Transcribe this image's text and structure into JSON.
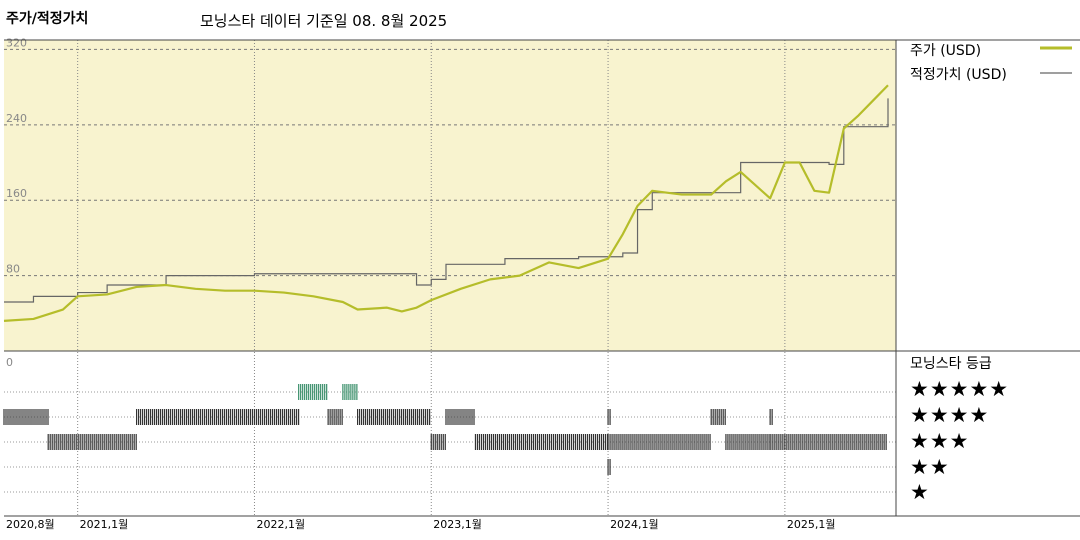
{
  "header": {
    "title": "주가/적정가치",
    "subtitle": "모닝스타 데이터 기준일 08. 8월 2025"
  },
  "legend": {
    "price_label": "주가 (USD)",
    "fair_label": "적정가치 (USD)",
    "price_color": "#b5bd2a",
    "fair_color": "#666666"
  },
  "rating": {
    "title": "모닝스타 등급",
    "rows": [
      "★★★★★",
      "★★★★",
      "★★★",
      "★★",
      "★"
    ]
  },
  "colors": {
    "panel_bg": "#f8f3cf",
    "five_star": "#3a8f6a",
    "bars": "#333333"
  },
  "chart_data": {
    "type": "line",
    "y_axis": {
      "ticks": [
        80,
        160,
        240,
        320
      ],
      "ylim": [
        0,
        330
      ],
      "grid": "dashed"
    },
    "rating_axis_label": "0",
    "x_axis": {
      "range": [
        "2020-08",
        "2025-08"
      ],
      "ticks": [
        {
          "date": "2020-08",
          "label": "2020,8월"
        },
        {
          "date": "2021-01",
          "label": "2021,1월"
        },
        {
          "date": "2022-01",
          "label": "2022,1월"
        },
        {
          "date": "2023-01",
          "label": "2023,1월"
        },
        {
          "date": "2024-01",
          "label": "2024,1월"
        },
        {
          "date": "2025-01",
          "label": "2025,1월"
        }
      ]
    },
    "price_series": {
      "name": "주가 (USD)",
      "points": [
        [
          "2020-08",
          32
        ],
        [
          "2020-10",
          34
        ],
        [
          "2020-12",
          44
        ],
        [
          "2021-01",
          58
        ],
        [
          "2021-03",
          60
        ],
        [
          "2021-05",
          68
        ],
        [
          "2021-07",
          70
        ],
        [
          "2021-09",
          66
        ],
        [
          "2021-11",
          64
        ],
        [
          "2022-01",
          64
        ],
        [
          "2022-03",
          62
        ],
        [
          "2022-05",
          58
        ],
        [
          "2022-07",
          52
        ],
        [
          "2022-08",
          44
        ],
        [
          "2022-10",
          46
        ],
        [
          "2022-11",
          42
        ],
        [
          "2022-12",
          46
        ],
        [
          "2023-01",
          54
        ],
        [
          "2023-03",
          66
        ],
        [
          "2023-05",
          76
        ],
        [
          "2023-07",
          80
        ],
        [
          "2023-09",
          94
        ],
        [
          "2023-11",
          88
        ],
        [
          "2024-01",
          98
        ],
        [
          "2024-02",
          124
        ],
        [
          "2024-03",
          154
        ],
        [
          "2024-04",
          170
        ],
        [
          "2024-06",
          166
        ],
        [
          "2024-08",
          166
        ],
        [
          "2024-09",
          180
        ],
        [
          "2024-10",
          190
        ],
        [
          "2024-12",
          162
        ],
        [
          "2025-01",
          200
        ],
        [
          "2025-02",
          200
        ],
        [
          "2025-03",
          170
        ],
        [
          "2025-04",
          168
        ],
        [
          "2025-05",
          236
        ],
        [
          "2025-06",
          250
        ],
        [
          "2025-07",
          266
        ],
        [
          "2025-08",
          282
        ]
      ]
    },
    "fair_value_series": {
      "name": "적정가치 (USD)",
      "points": [
        [
          "2020-08",
          52
        ],
        [
          "2020-10",
          58
        ],
        [
          "2021-01",
          62
        ],
        [
          "2021-03",
          70
        ],
        [
          "2021-07",
          80
        ],
        [
          "2022-01",
          82
        ],
        [
          "2022-12",
          70
        ],
        [
          "2023-01",
          76
        ],
        [
          "2023-02",
          92
        ],
        [
          "2023-06",
          98
        ],
        [
          "2023-09",
          98
        ],
        [
          "2023-11",
          100
        ],
        [
          "2024-02",
          104
        ],
        [
          "2024-03",
          150
        ],
        [
          "2024-04",
          168
        ],
        [
          "2024-10",
          200
        ],
        [
          "2025-04",
          198
        ],
        [
          "2025-05",
          238
        ],
        [
          "2025-07",
          238
        ],
        [
          "2025-08",
          268
        ]
      ]
    },
    "rating_periods": [
      {
        "stars": 4,
        "from": "2020-08",
        "to": "2020-11"
      },
      {
        "stars": 3,
        "from": "2020-11",
        "to": "2021-05"
      },
      {
        "stars": 4,
        "from": "2021-05",
        "to": "2022-04"
      },
      {
        "stars": 5,
        "from": "2022-04",
        "to": "2022-06"
      },
      {
        "stars": 4,
        "from": "2022-06",
        "to": "2022-07"
      },
      {
        "stars": 5,
        "from": "2022-07",
        "to": "2022-08"
      },
      {
        "stars": 4,
        "from": "2022-08",
        "to": "2023-01"
      },
      {
        "stars": 3,
        "from": "2023-01",
        "to": "2023-02"
      },
      {
        "stars": 4,
        "from": "2023-02",
        "to": "2023-04"
      },
      {
        "stars": 3,
        "from": "2023-04",
        "to": "2024-01"
      },
      {
        "stars": 4,
        "from": "2024-01",
        "to": "2024-01"
      },
      {
        "stars": 2,
        "from": "2024-01",
        "to": "2024-01"
      },
      {
        "stars": 3,
        "from": "2024-01",
        "to": "2024-08"
      },
      {
        "stars": 4,
        "from": "2024-08",
        "to": "2024-09"
      },
      {
        "stars": 3,
        "from": "2024-09",
        "to": "2024-12"
      },
      {
        "stars": 4,
        "from": "2024-12",
        "to": "2024-12"
      },
      {
        "stars": 3,
        "from": "2024-12",
        "to": "2025-08"
      }
    ]
  }
}
